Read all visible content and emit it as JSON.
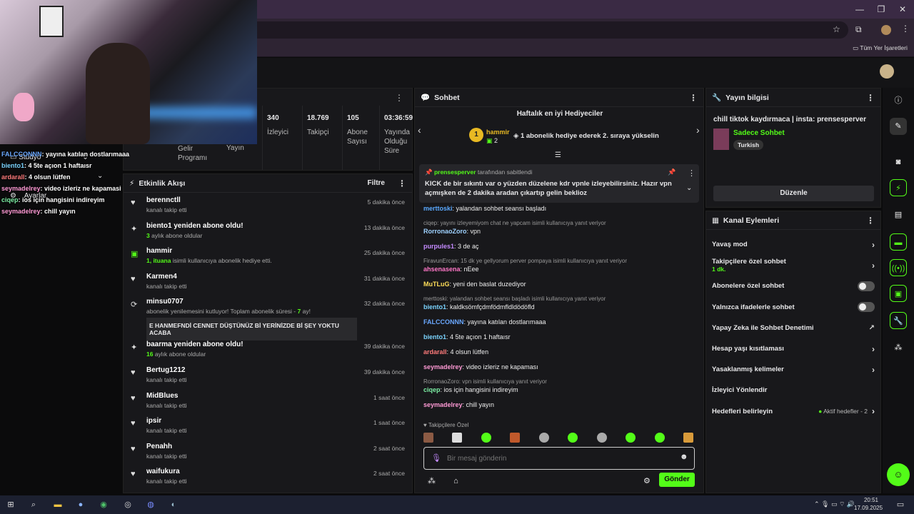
{
  "browser": {
    "bookmarks_label": "Tüm Yer İşaretleri"
  },
  "overlay": {
    "menu_items": [
      "Stüdyo",
      "Ayarlar"
    ],
    "chat": [
      {
        "user": "FALCCONNN",
        "text": ": yayına katılan dostlarımaaa"
      },
      {
        "user": "biento1",
        "text": ": 4 5te açıon 1 haftaısr"
      },
      {
        "user": "ardarall",
        "text": ": 4 olsun lütfen"
      },
      {
        "user": "seymadelrey",
        "text": ": video izleriz ne kapamasi"
      },
      {
        "user": "ciqep",
        "text": ": ios için hangisini indireyim"
      },
      {
        "user": "seymadelrey",
        "text": ": chill yayın"
      }
    ]
  },
  "stats": {
    "partial_labels": [
      "Gelir Programı",
      "Yayın"
    ],
    "items": [
      {
        "value": "340",
        "label": "İzleyici"
      },
      {
        "value": "18.769",
        "label": "Takipçi"
      },
      {
        "value": "105",
        "label": "Abone Sayısı"
      },
      {
        "value": "03:36:59",
        "label": "Yayında Olduğu Süre"
      }
    ]
  },
  "activity": {
    "title": "Etkinlik Akışı",
    "filter": "Filtre",
    "items": [
      {
        "icon": "heart",
        "name": "berennctll",
        "sub": "kanalı takip etti",
        "time": "5 dakika önce"
      },
      {
        "icon": "sparkle",
        "name": "biento1 yeniden abone oldu!",
        "sub_num": "3",
        "sub": " aylık abone oldular",
        "time": "13 dakika önce"
      },
      {
        "icon": "gift",
        "name": "hammir",
        "sub_num": "1, ituana",
        "sub": " isimli kullanıcıya abonelik hediye etti.",
        "time": "25 dakika önce"
      },
      {
        "icon": "heart",
        "name": "Karmen4",
        "sub": "kanalı takip etti",
        "time": "31 dakika önce"
      },
      {
        "icon": "renew",
        "name": "minsu0707",
        "sub": "abonelik yenilemesini kutluyor! Toplam abonelik süresi - ",
        "sub_num2": "7",
        "sub2": " ay!",
        "message": "E HANMEFNDİ CENNET DÜŞTÜNÜZ Bİ YERİNİZDE Bİ ŞEY YOKTU ACABA",
        "time": "32 dakika önce"
      },
      {
        "icon": "sparkle",
        "name": "baarma yeniden abone oldu!",
        "sub_num": "16",
        "sub": " aylık abone oldular",
        "time": "39 dakika önce"
      },
      {
        "icon": "heart",
        "name": "Bertug1212",
        "sub": "kanalı takip etti",
        "time": "39 dakika önce"
      },
      {
        "icon": "heart",
        "name": "MidBlues",
        "sub": "kanalı takip etti",
        "time": "1 saat önce"
      },
      {
        "icon": "heart",
        "name": "ipsir",
        "sub": "kanalı takip etti",
        "time": "1 saat önce"
      },
      {
        "icon": "heart",
        "name": "Penahh",
        "sub": "kanalı takip etti",
        "time": "2 saat önce"
      },
      {
        "icon": "heart",
        "name": "waifukura",
        "sub": "kanalı takip etti",
        "time": "2 saat önce"
      }
    ]
  },
  "chat": {
    "title": "Sohbet",
    "gifters_title": "Haftalık en iyi Hediyeciler",
    "top_gifter": {
      "rank": "1",
      "name": "hammir",
      "count": "2"
    },
    "gifter_cta": "1 abonelik hediye ederek 2. sıraya yükselin",
    "pinned": {
      "user": "prensesperver",
      "by": "tarafından sabitlendi",
      "text": "KICK de bir sıkıntı var o yüzden düzelene kdr vpnle izleyebilirsiniz. Hazır vpn açmışken de 2 dakika aradan çıkartıp gelin beklioz"
    },
    "messages": [
      {
        "user": "merttoski",
        "color": "#5aa9ff",
        "text": ": yalandan sohbet seansı başladı"
      },
      {
        "reply": "ciqep: yayını izleyemiyom chat ne yapcam isimli kullanıcıya yanıt veriyor",
        "user": "RorronaoZoro",
        "color": "#9fd2ff",
        "text": ": vpn"
      },
      {
        "user": "purpules1",
        "color": "#c58bff",
        "text": ": 3 de aç"
      },
      {
        "reply": "FiravunErcan: 15 dk ye gellyorum perver pompaya isimli kullanıcıya yanıt veriyor",
        "user": "ahsenasena",
        "color": "#ff77c8",
        "text": ": nEee"
      },
      {
        "user": "MuTLuG",
        "color": "#ffde59",
        "text": ": yeni den baslat duzediyor"
      },
      {
        "reply": "merttoski: yalandan sohbet seansı başladı isimli kullanıcıya yanıt veriyor",
        "user": "biento1",
        "color": "#7bd4ff",
        "text": ": kaldksömfçdmfödmfldldödöfld"
      },
      {
        "user": "FALCCONNN",
        "color": "#6aa8ff",
        "text": ": yayına katılan dostlarımaaa"
      },
      {
        "user": "biento1",
        "color": "#7bd4ff",
        "text": ": 4 5te açıon 1 haftaısr"
      },
      {
        "user": "ardarall",
        "color": "#ff7b7b",
        "text": ": 4 olsun lütfen"
      },
      {
        "user": "seymadelrey",
        "color": "#ff9ad5",
        "text": ": video izleriz ne kapaması"
      },
      {
        "reply": "RorronaoZoro: vpn isimli kullanıcıya yanıt veriyor",
        "user": "ciqep",
        "color": "#7df0a5",
        "text": ": ios için hangisini indireyim"
      },
      {
        "user": "seymadelrey",
        "color": "#ff9ad5",
        "text": ": chill yayın"
      }
    ],
    "followers_only": "Takipçilere Özel",
    "input_placeholder": "Bir mesaj gönderin",
    "send_label": "Gönder"
  },
  "info": {
    "title": "Yayın bilgisi",
    "stream_title": "chill tiktok kaydırmaca | insta: prensesperver",
    "category": "Sadece Sohbet",
    "tag": "Turkish",
    "edit_label": "Düzenle"
  },
  "channel_actions": {
    "title": "Kanal Eylemleri",
    "items": [
      {
        "label": "Yavaş mod",
        "type": "chevron"
      },
      {
        "label": "Takipçilere özel sohbet",
        "sub": "1 dk.",
        "type": "chevron"
      },
      {
        "label": "Abonelere özel sohbet",
        "type": "toggle"
      },
      {
        "label": "Yalnızca ifadelerle sohbet",
        "type": "toggle"
      },
      {
        "label": "Yapay Zeka ile Sohbet Denetimi",
        "type": "external"
      },
      {
        "label": "Hesap yaşı kısıtlaması",
        "type": "chevron"
      },
      {
        "label": "Yasaklanmış kelimeler",
        "type": "chevron"
      },
      {
        "label": "İzleyici Yönlendir",
        "type": "none"
      },
      {
        "label": "Hedefleri belirleyin",
        "status": "Aktif hedefler - 2",
        "type": "chevron"
      }
    ]
  },
  "taskbar": {
    "time": "20:51",
    "date": "17.09.2025"
  }
}
